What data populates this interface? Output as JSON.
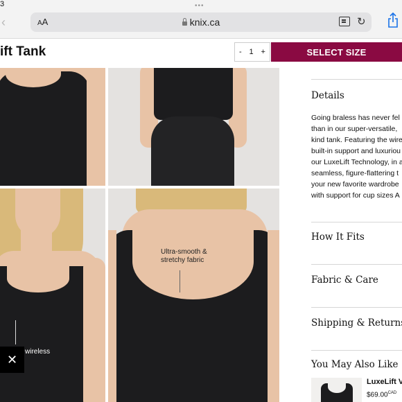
{
  "status": {
    "time": "3"
  },
  "browser": {
    "text_size_label_small": "A",
    "text_size_label_large": "A",
    "url": "knix.ca"
  },
  "product": {
    "title": "ift Tank",
    "quantity": "1",
    "qty_minus": "-",
    "qty_plus": "+",
    "select_size_label": "SELECT SIZE"
  },
  "gallery": {
    "annotation_fabric": "Ultra-smooth &\nstretchy fabric",
    "annotation_wireless": "wireless"
  },
  "details": {
    "heading": "Details",
    "lines": [
      "Going braless has never fel",
      "than in our super-versatile,",
      "kind tank. Featuring the wire",
      "built-in support and luxuriou",
      "our LuxeLift Technology, in a",
      "seamless, figure-flattering t",
      "your new favorite wardrobe",
      "with support for cup sizes A"
    ]
  },
  "sections": {
    "how_it_fits": "How It Fits",
    "fabric_care": "Fabric & Care",
    "shipping_returns": "Shipping & Returns",
    "also_like": "You May Also Like"
  },
  "recommendation": {
    "name": "LuxeLift V-",
    "price": "$69.00",
    "currency": "CAD"
  },
  "colors": {
    "accent": "#8a0a42",
    "garment": "#1c1c1e"
  }
}
